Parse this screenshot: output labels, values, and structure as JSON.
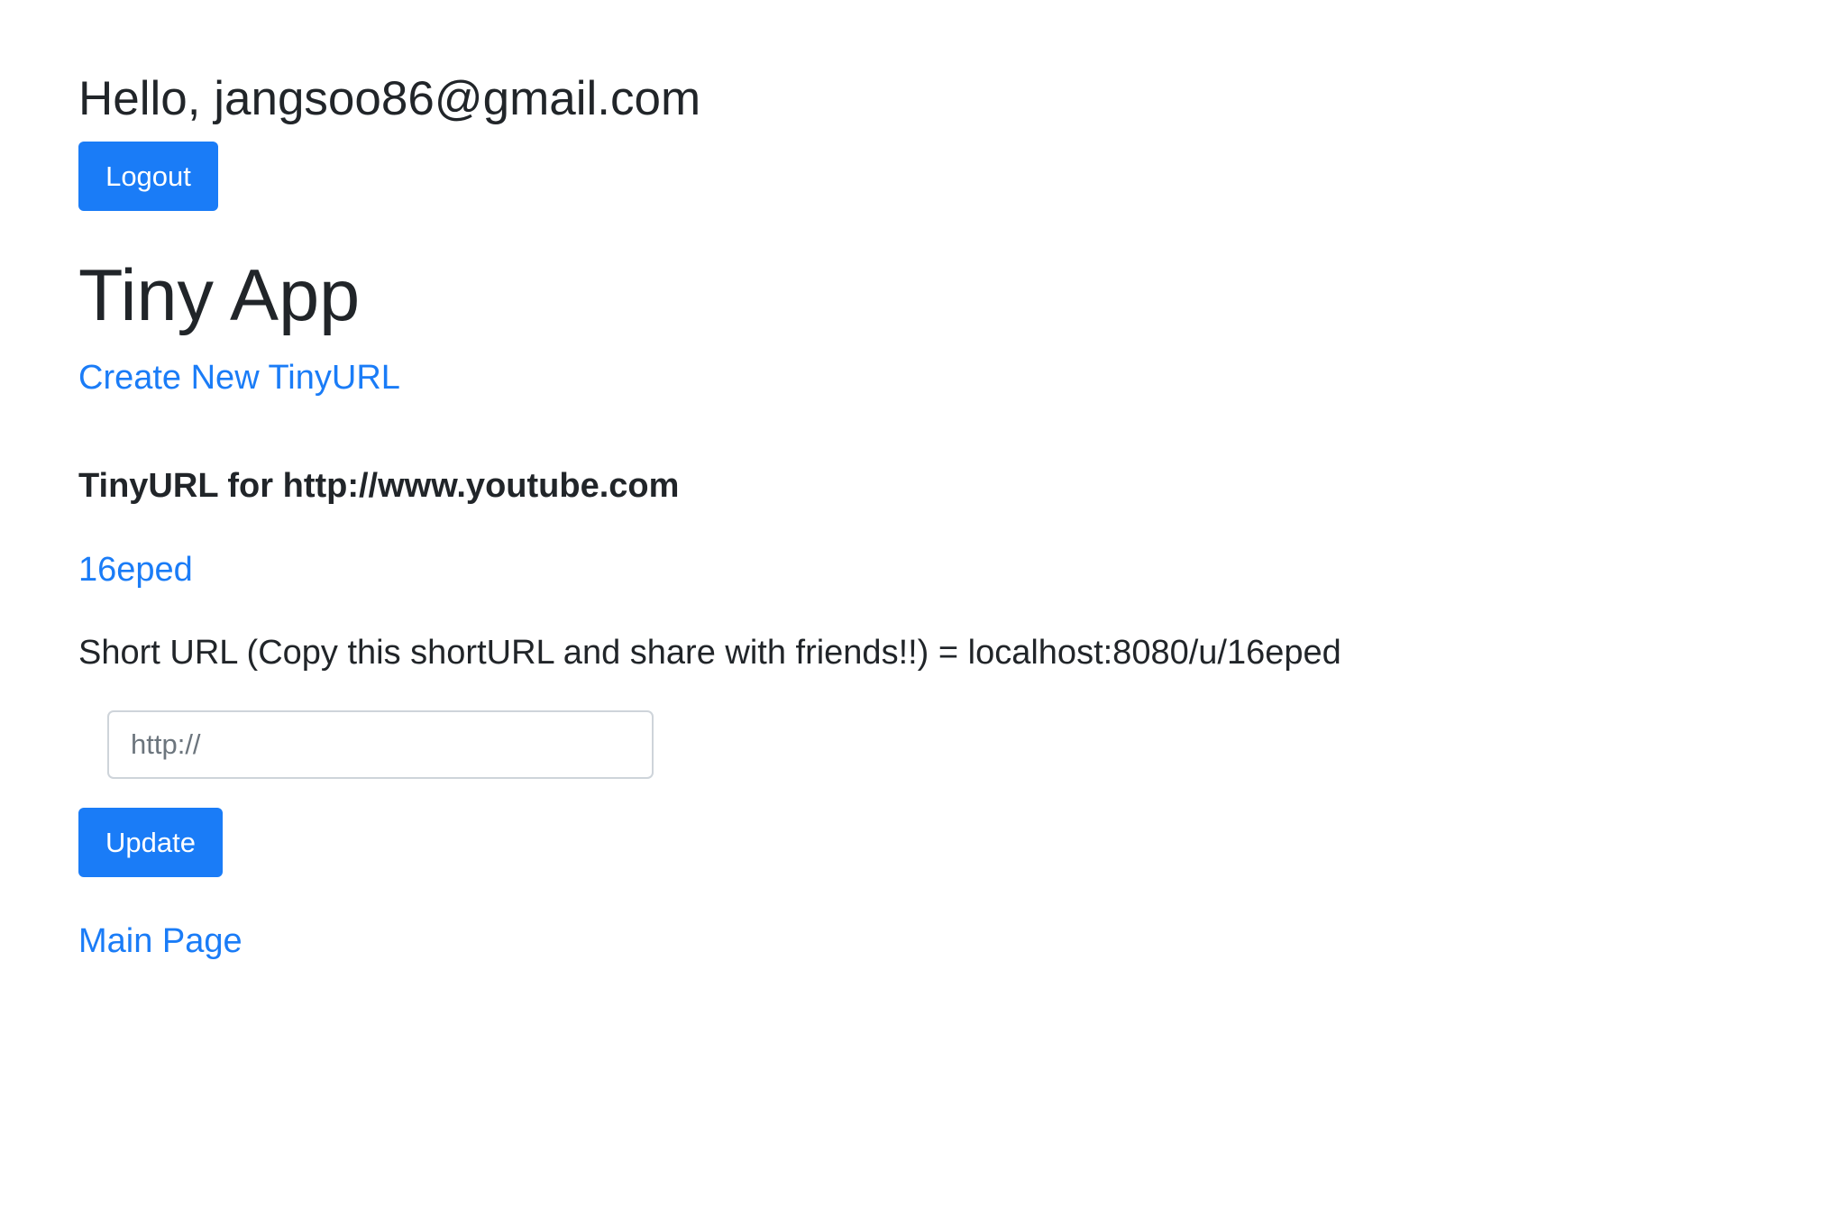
{
  "header": {
    "greeting": "Hello, jangsoo86@gmail.com",
    "logout_label": "Logout"
  },
  "app": {
    "title": "Tiny App",
    "create_link_label": "Create New TinyURL"
  },
  "url_detail": {
    "heading": "TinyURL for http://www.youtube.com",
    "short_code": "16eped",
    "short_url_text": "Short URL (Copy this shortURL and share with friends!!) = localhost:8080/u/16eped"
  },
  "update_form": {
    "input_placeholder": "http://",
    "input_value": "",
    "update_label": "Update"
  },
  "footer": {
    "main_page_link_label": "Main Page"
  },
  "colors": {
    "accent": "#1a7cf7",
    "text": "#212529",
    "input_border": "#ced4da",
    "placeholder": "#6c757d"
  }
}
